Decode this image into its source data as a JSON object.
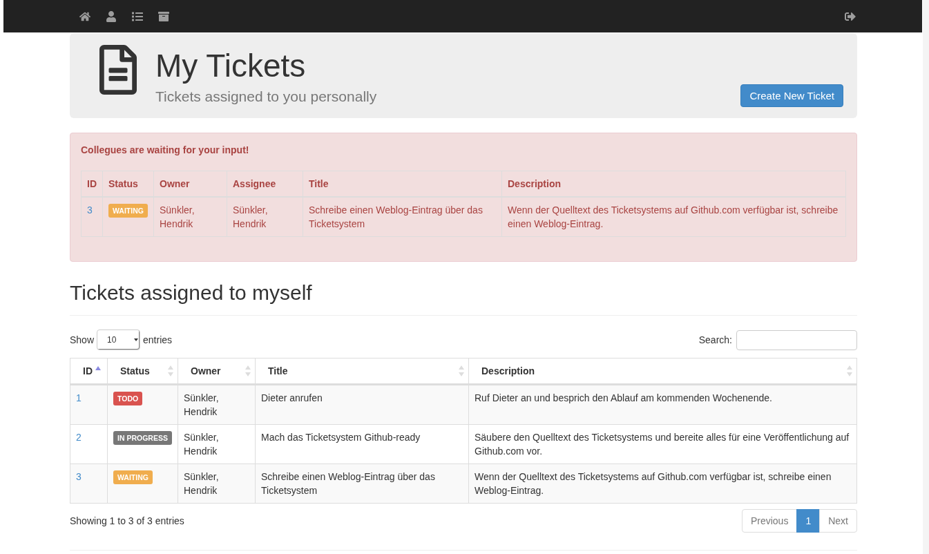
{
  "header": {
    "title": "My Tickets",
    "subtitle": "Tickets assigned to you personally",
    "button": "Create New Ticket"
  },
  "alert": {
    "heading": "Collegues are waiting for your input!",
    "columns": [
      "ID",
      "Status",
      "Owner",
      "Assignee",
      "Title",
      "Description"
    ],
    "rows": [
      {
        "id": "3",
        "status": {
          "label": "WAITING",
          "kind": "waiting"
        },
        "owner": "Sünkler, Hendrik",
        "assignee": "Sünkler, Hendrik",
        "title": "Schreibe einen Weblog-Eintrag über das Ticketsystem",
        "description": "Wenn der Quelltext des Ticketsystems auf Github.com verfügbar ist, schreibe einen Weblog-Eintrag."
      }
    ]
  },
  "section_title": "Tickets assigned to myself",
  "length": {
    "before": "Show",
    "value": "10",
    "after": "entries"
  },
  "search": {
    "label": "Search:"
  },
  "table": {
    "columns": [
      {
        "label": "ID",
        "sorted": true
      },
      {
        "label": "Status",
        "sorted": false
      },
      {
        "label": "Owner",
        "sorted": false
      },
      {
        "label": "Title",
        "sorted": false
      },
      {
        "label": "Description",
        "sorted": false
      }
    ],
    "rows": [
      {
        "id": "1",
        "status": {
          "label": "TODO",
          "kind": "todo"
        },
        "owner": "Sünkler, Hendrik",
        "title": "Dieter anrufen",
        "description": "Ruf Dieter an und besprich den Ablauf am kommenden Wochenende."
      },
      {
        "id": "2",
        "status": {
          "label": "IN PROGRESS",
          "kind": "in_progress"
        },
        "owner": "Sünkler, Hendrik",
        "title": "Mach das Ticketsystem Github-ready",
        "description": "Säubere den Quelltext des Ticketsystems und bereite alles für eine Veröffentlichung auf Github.com vor."
      },
      {
        "id": "3",
        "status": {
          "label": "WAITING",
          "kind": "waiting"
        },
        "owner": "Sünkler, Hendrik",
        "title": "Schreibe einen Weblog-Eintrag über das Ticketsystem",
        "description": "Wenn der Quelltext des Ticketsystems auf Github.com verfügbar ist, schreibe einen Weblog-Eintrag."
      }
    ]
  },
  "info": "Showing 1 to 3 of 3 entries",
  "pagination": {
    "previous": {
      "label": "Previous",
      "disabled": true
    },
    "pages": [
      {
        "label": "1",
        "selected": true
      }
    ],
    "next": {
      "label": "Next",
      "disabled": true
    }
  }
}
